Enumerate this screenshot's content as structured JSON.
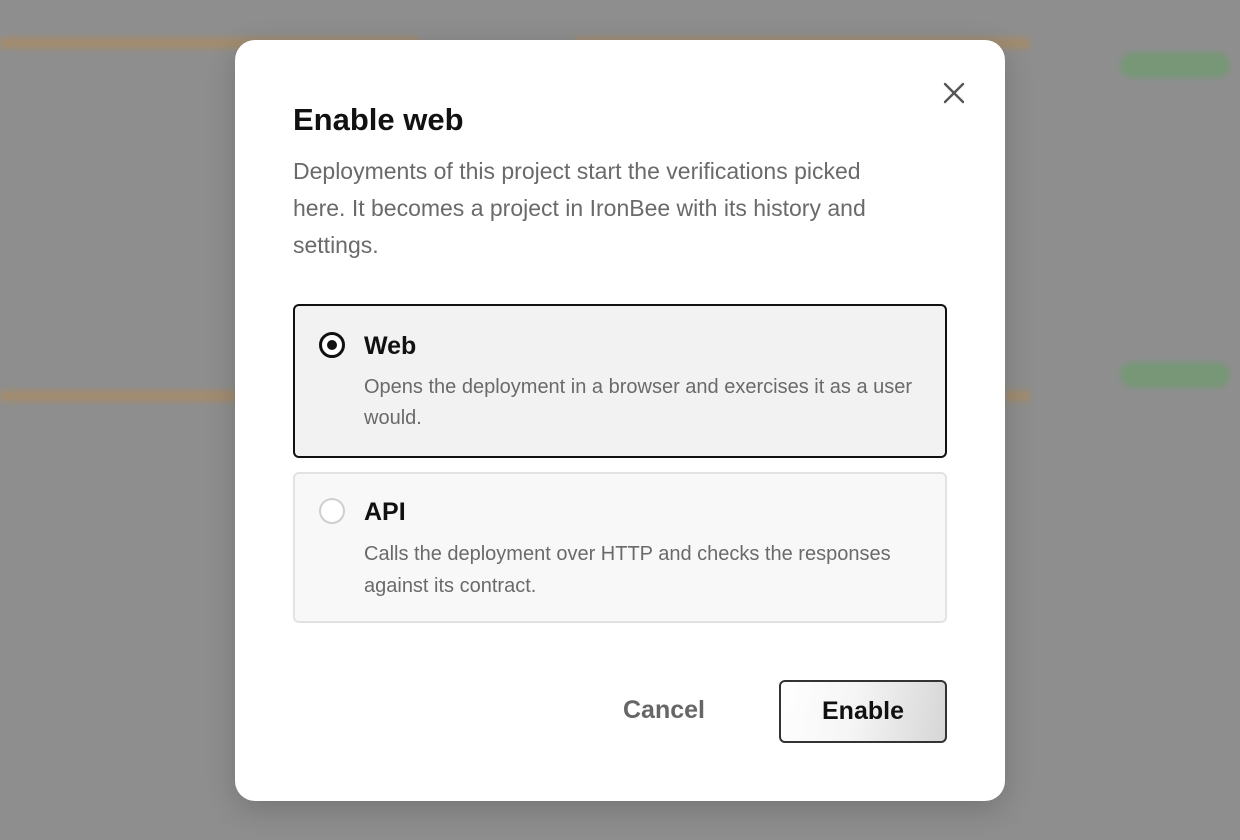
{
  "dialog": {
    "title": "Enable web",
    "description": "Deployments of this project start the verifications picked here. It becomes a project in IronBee with its history and settings.",
    "options": [
      {
        "label": "Web",
        "description": "Opens the deployment in a browser and exercises it as a user would.",
        "selected": true
      },
      {
        "label": "API",
        "description": "Calls the deployment over HTTP and checks the responses against its contract.",
        "selected": false
      }
    ],
    "cancel_label": "Cancel",
    "confirm_label": "Enable"
  },
  "icons": {
    "close": "close-icon",
    "radio_selected": "radio-selected-icon",
    "radio_unselected": "radio-unselected-icon"
  },
  "colors": {
    "overlay": "#8f8f8f",
    "modal_background": "#ffffff",
    "selected_border": "#111111",
    "selected_background": "#f2f2f2",
    "unselected_border": "#e2e2e2",
    "muted_text": "#6a6a6a"
  }
}
